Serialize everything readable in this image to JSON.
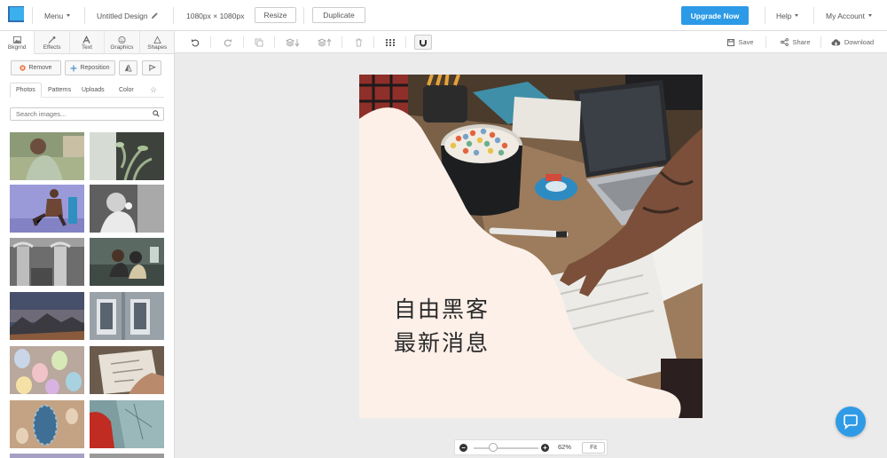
{
  "topbar": {
    "menu_label": "Menu",
    "design_title": "Untitled Design",
    "dimensions": "1080px × 1080px",
    "resize_label": "Resize",
    "duplicate_label": "Duplicate",
    "upgrade_label": "Upgrade Now",
    "help_label": "Help",
    "account_label": "My Account"
  },
  "category_tabs": [
    {
      "label": "Bkgrnd",
      "icon": "image-icon",
      "active": true
    },
    {
      "label": "Effects",
      "icon": "wand-icon",
      "active": false
    },
    {
      "label": "Text",
      "icon": "text-icon",
      "active": false
    },
    {
      "label": "Graphics",
      "icon": "smiley-icon",
      "active": false
    },
    {
      "label": "Shapes",
      "icon": "triangle-icon",
      "active": false
    }
  ],
  "background_actions": {
    "remove_label": "Remove",
    "reposition_label": "Reposition",
    "flip_icon": "flip-icon",
    "flag_icon": "flag-icon"
  },
  "sub_tabs": [
    {
      "label": "Photos",
      "active": true
    },
    {
      "label": "Patterns",
      "active": false
    },
    {
      "label": "Uploads",
      "active": false
    },
    {
      "label": "Color",
      "active": false
    },
    {
      "label": "☆",
      "active": false
    }
  ],
  "search": {
    "placeholder": "Search images..."
  },
  "thumbnails": [
    {
      "subject": "woman-in-field",
      "color": "#7f8b6e"
    },
    {
      "subject": "plant-window",
      "color": "#4a4f46"
    },
    {
      "subject": "person-sitting-purple",
      "color": "#8f8fd0"
    },
    {
      "subject": "person-bw",
      "color": "#7d7d7d"
    },
    {
      "subject": "columns-bw",
      "color": "#8c8c8c"
    },
    {
      "subject": "couple-couch",
      "color": "#57635a"
    },
    {
      "subject": "mountain-sunset",
      "color": "#4f5866"
    },
    {
      "subject": "building-windows",
      "color": "#8a9097"
    },
    {
      "subject": "easter-eggs",
      "color": "#b9a59b"
    },
    {
      "subject": "hand-drawing",
      "color": "#6a5b4e"
    },
    {
      "subject": "blue-eggs",
      "color": "#b79479"
    },
    {
      "subject": "red-coat-map",
      "color": "#6c8a8c"
    }
  ],
  "canvas_toolbar": {
    "save_label": "Save",
    "share_label": "Share",
    "download_label": "Download"
  },
  "design": {
    "headline_line1": "自由黑客",
    "headline_line2": "最新消息",
    "blob_color": "#fcf0e9"
  },
  "zoom": {
    "percent_label": "62%",
    "fit_label": "Fit",
    "level": 0.3
  },
  "colors": {
    "accent": "#2c9ae6",
    "logo_light": "#3ab0ee",
    "logo_dark": "#2d6fb0"
  }
}
